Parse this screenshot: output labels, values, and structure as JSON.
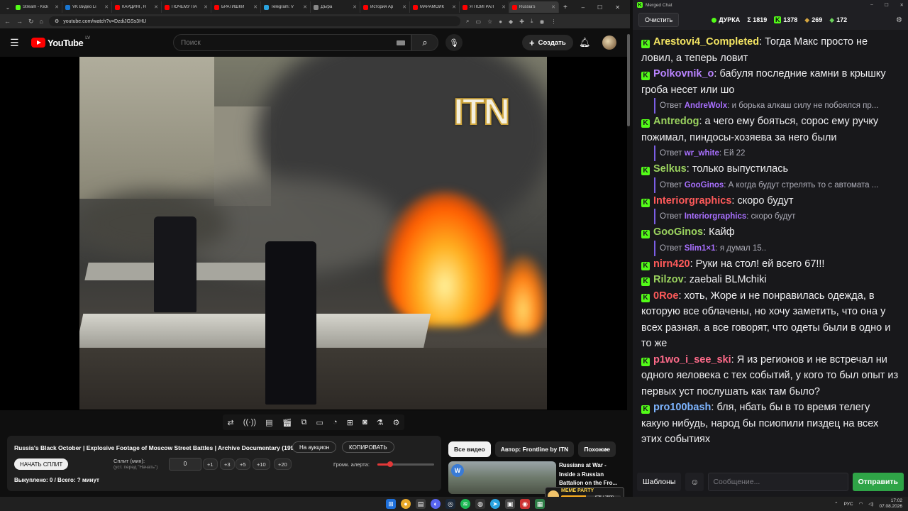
{
  "browser": {
    "tabs": [
      {
        "label": "Stream - Kick",
        "color": "#53fc18"
      },
      {
        "label": "VK Видео Li",
        "color": "#1976d2"
      },
      {
        "label": "КАРДИНГ, Н",
        "color": "#ff0000"
      },
      {
        "label": "ПОЧЕМУ ПА",
        "color": "#ff0000"
      },
      {
        "label": "БРАТИШКИ",
        "color": "#ff0000"
      },
      {
        "label": "Telegram: V",
        "color": "#2aa3df"
      },
      {
        "label": "Дъ/ра",
        "color": "#888888"
      },
      {
        "label": "История Ар",
        "color": "#ff0000"
      },
      {
        "label": "МАРАМОЙК",
        "color": "#ff0000"
      },
      {
        "label": "Я ПОИГРАЛ",
        "color": "#ff0000"
      },
      {
        "label": "Russia's",
        "color": "#ff0000"
      }
    ],
    "url": "youtube.com/watch?v=DzdiJGSs3HU"
  },
  "youtube": {
    "logo": "YouTube",
    "region": "LV",
    "search_placeholder": "Поиск",
    "create_label": "Создать",
    "video_overlay": "ITN",
    "title": "Russia's Black October | Explosive Footage of Moscow Street Battles | Archive Documentary (1993)",
    "auction_label": "На аукцион",
    "copy_label": "КОПИРОВАТЬ",
    "start_split_label": "НАЧАТЬ СПЛИТ",
    "split_label": "Сплит (мин):",
    "split_sub": "(уст. перед \"Начать\")",
    "split_value": "0",
    "increments": [
      "+1",
      "+3",
      "+5",
      "+10",
      "+20"
    ],
    "alert_volume_label": "Громк. алерта:",
    "alert_volume": 0.22,
    "bought_label": "Выкуплено: 0 / Всего: ? минут",
    "chips": [
      "Все видео",
      "Автор: Frontline by ITN",
      "Похожие"
    ],
    "recommended": {
      "title": "Russians at War - Inside a Russian Battalion on the Fro...",
      "badge": "W"
    }
  },
  "xp_widget": {
    "name": "MEME PARTY",
    "progress_text": "625 / 1500",
    "progress": 0.42
  },
  "taskbar": {
    "lang": "РУС",
    "time": "17:02",
    "date": "07.08.2026"
  },
  "chat": {
    "window_title": "Merged Chat",
    "clear_label": "Очистить",
    "streamer": "ДУРКА",
    "total": "Σ 1819",
    "kick_count": "1378",
    "other1": "269",
    "other2": "172",
    "messages": [
      {
        "type": "msg",
        "user": "Arestovi4_Completed",
        "color": "#f5e663",
        "text": "Тогда Макс просто не ловил, а теперь ловит"
      },
      {
        "type": "msg",
        "user": "Polkovnik_o",
        "color": "#b983ff",
        "text": "бабуля последние камни в крышку гроба несет или шо"
      },
      {
        "type": "reply",
        "user": "AndreWolx",
        "text": "и борька алкаш силу не побоялся пр..."
      },
      {
        "type": "msg",
        "user": "Antredog",
        "color": "#9bd35f",
        "text": "а чего ему бояться, сорос ему ручку пожимал, пиндосы-хозяева за него были"
      },
      {
        "type": "reply",
        "user": "wr_white",
        "text": "Ей 22"
      },
      {
        "type": "msg",
        "user": "Selkus",
        "color": "#9bd35f",
        "text": "только выпустилась"
      },
      {
        "type": "reply",
        "user": "GooGinos",
        "text": "А когда будут стрелять то с автомата ..."
      },
      {
        "type": "msg",
        "user": "Interiorgraphics",
        "color": "#ff5a5a",
        "text": "скоро будут"
      },
      {
        "type": "reply",
        "user": "Interiorgraphics",
        "text": "скоро будут"
      },
      {
        "type": "msg",
        "user": "GooGinos",
        "color": "#9bd35f",
        "text": "Кайф"
      },
      {
        "type": "reply",
        "user": "Slim1×1",
        "text": "я думал 15.."
      },
      {
        "type": "msg",
        "user": "nirn420",
        "color": "#ff5a5a",
        "text": "Руки на стол! ей всего 67!!!"
      },
      {
        "type": "msg",
        "user": "Rilzov",
        "color": "#9bd35f",
        "text": "zaebali BLMchiki"
      },
      {
        "type": "msg",
        "user": "0Roe",
        "color": "#ff5a5a",
        "text": "хоть, Жоре и не понравилась одежда, в которую все облачены, но хочу заметить, что она у всех разная. а все говорят, что одеты были в одно и то же"
      },
      {
        "type": "msg",
        "user": "p1wo_i_see_ski",
        "color": "#ff6b8a",
        "text": "Я из регионов и не встречал ни одного яеловека с тех событий, у кого то был опыт из первых уст послушать как там было?"
      },
      {
        "type": "msg",
        "user": "pro100bash",
        "color": "#7db4ff",
        "text": "бля, нбать бы в то время телегу какую нибудь, народ бы псиопили пиздец на всех этих событиях"
      }
    ],
    "reply_prefix": "Ответ",
    "templates_label": "Шаблоны",
    "input_placeholder": "Сообщение...",
    "send_label": "Отправить"
  }
}
